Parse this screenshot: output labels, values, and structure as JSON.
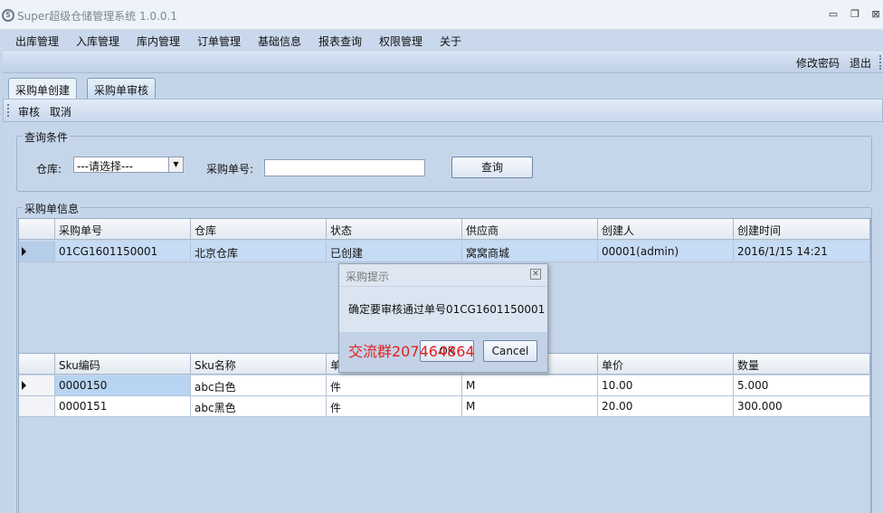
{
  "window": {
    "title": "Super超级仓储管理系统 1.0.0.1",
    "icon": "S",
    "minimize": "▭",
    "restore": "❐",
    "close": "⊠"
  },
  "menu": [
    "出库管理",
    "入库管理",
    "库内管理",
    "订单管理",
    "基础信息",
    "报表查询",
    "权限管理",
    "关于"
  ],
  "user_bar": {
    "change_password": "修改密码",
    "logout": "退出"
  },
  "tabs": [
    {
      "label": "采购单创建",
      "active": false
    },
    {
      "label": "采购单审核",
      "active": true
    }
  ],
  "toolbar": {
    "audit": "审核",
    "cancel": "取消"
  },
  "query": {
    "legend": "查询条件",
    "warehouse_label": "仓库:",
    "warehouse_value": "---请选择---",
    "order_no_label": "采购单号:",
    "order_no_value": "",
    "query_button": "查询"
  },
  "orders": {
    "legend": "采购单信息",
    "columns": [
      "采购单号",
      "仓库",
      "状态",
      "供应商",
      "创建人",
      "创建时间"
    ],
    "rows": [
      [
        "01CG1601150001",
        "北京仓库",
        "已创建",
        "窝窝商城",
        "00001(admin)",
        "2016/1/15 14:21"
      ]
    ]
  },
  "details": {
    "columns": [
      "Sku编码",
      "Sku名称",
      "单",
      "",
      "单价",
      "数量"
    ],
    "rows": [
      [
        "0000150",
        "abc白色",
        "件",
        "M",
        "10.00",
        "5.000"
      ],
      [
        "0000151",
        "abc黑色",
        "件",
        "M",
        "20.00",
        "300.000"
      ]
    ]
  },
  "dialog": {
    "title": "采购提示",
    "message": "确定要审核通过单号01CG1601150001",
    "ok": "OK",
    "cancel": "Cancel",
    "close_icon": "✕",
    "watermark": "交流群207464864"
  },
  "colors": {
    "menu_bg": "#c9d8ec",
    "selected_row": "#c6dbf4",
    "watermark": "#e32020"
  }
}
